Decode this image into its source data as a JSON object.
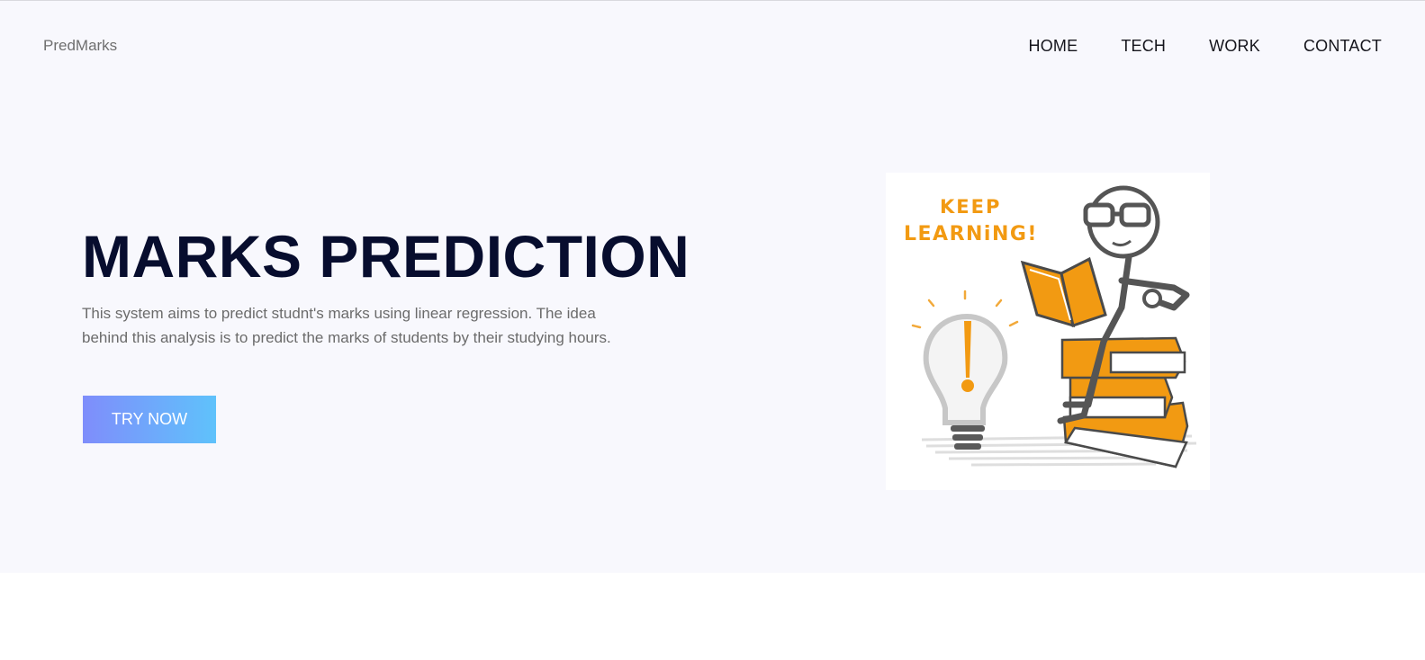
{
  "header": {
    "brand": "PredMarks",
    "nav": {
      "home": "HOME",
      "tech": "TECH",
      "work": "WORK",
      "contact": "CONTACT"
    }
  },
  "hero": {
    "title": "MARKS PREDICTION",
    "description": "This system aims to predict studnt's marks using linear regression. The idea behind this analysis is to predict the marks of students by their studying hours.",
    "cta_label": "TRY NOW",
    "illustration": {
      "icon": "keep-learning-illustration",
      "text_line1": "KEEP",
      "text_line2": "LEARNiNG!"
    }
  },
  "colors": {
    "hero_bg": "#f8f8fd",
    "title": "#070d2e",
    "cta_start": "#7f8dfb",
    "cta_end": "#5fc2fb",
    "accent_orange": "#f29a12"
  }
}
